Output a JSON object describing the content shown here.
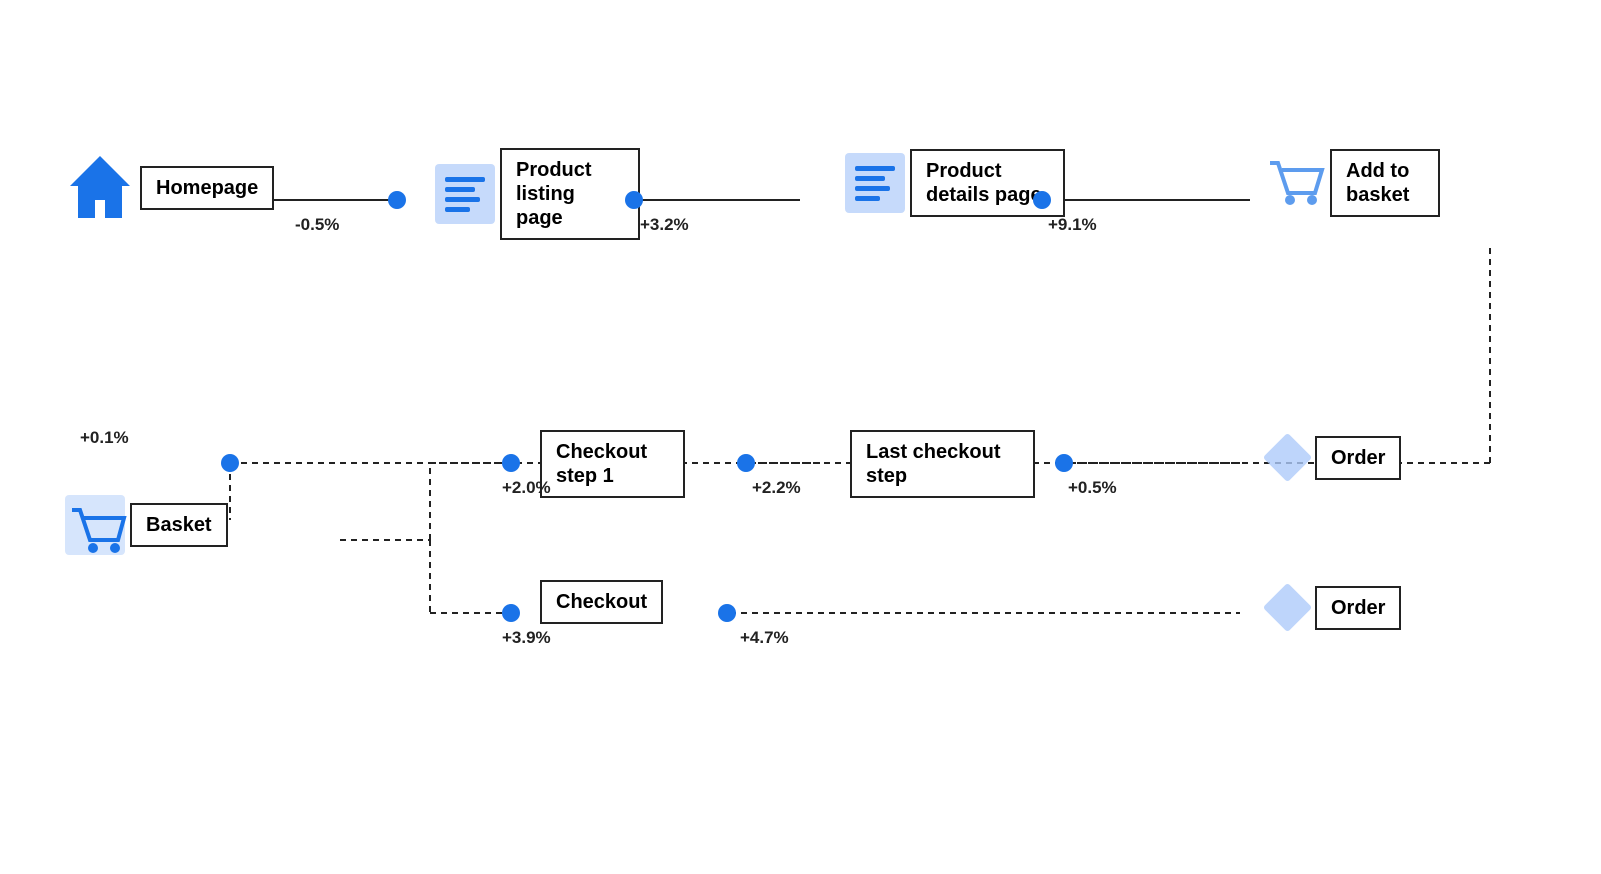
{
  "nodes": {
    "homepage": {
      "label": "Homepage",
      "pct_right": "-0.5%"
    },
    "plp": {
      "label": "Product\nlisting page",
      "pct_right": "+3.2%"
    },
    "pdp": {
      "label": "Product\ndetails page",
      "pct_right": "+9.1%"
    },
    "atb": {
      "label": "Add to\nbasket"
    },
    "basket": {
      "label": "Basket",
      "pct_top": "+0.1%",
      "pct_right": ""
    },
    "cs1": {
      "label": "Checkout\nstep 1",
      "pct_left": "+2.0%",
      "pct_right": "+2.2%"
    },
    "lcs": {
      "label": "Last checkout\nstep",
      "pct_right": "+0.5%"
    },
    "order1": {
      "label": "Order"
    },
    "checkout": {
      "label": "Checkout",
      "pct_left": "+3.9%",
      "pct_right": "+4.7%"
    },
    "order2": {
      "label": "Order"
    }
  },
  "colors": {
    "blue": "#1a73e8",
    "light_blue": "#aecbfa",
    "border": "#222222",
    "bg": "#ffffff"
  }
}
